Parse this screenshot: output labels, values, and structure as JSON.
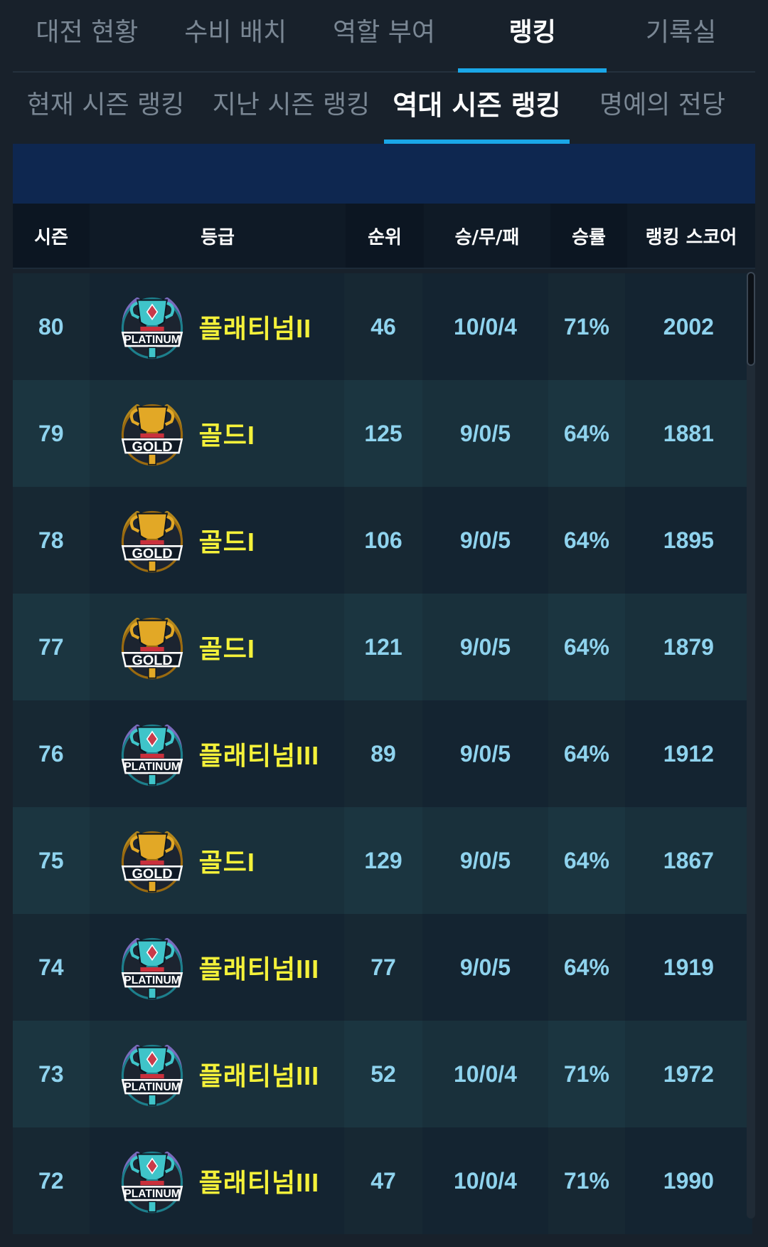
{
  "top_tabs": [
    "대전 현황",
    "수비 배치",
    "역할 부여",
    "랭킹",
    "기록실"
  ],
  "active_top_tab": "랭킹",
  "sub_tabs": [
    "현재 시즌 랭킹",
    "지난 시즌 랭킹",
    "역대 시즌 랭킹",
    "명예의 전당"
  ],
  "active_sub_tab": "역대 시즌 랭킹",
  "accent_color": "#1aa7e8",
  "grade_text_color": "#f4f13a",
  "value_text_color": "#8fd3ee",
  "table": {
    "headers": [
      "시즌",
      "등급",
      "순위",
      "승/무/패",
      "승률",
      "랭킹 스코어"
    ],
    "rows": [
      {
        "season": "80",
        "badge": "platinum-badge",
        "badge_text": "PLATINUM",
        "grade": "플래티넘II",
        "rank": "46",
        "wdl": "10/0/4",
        "rate": "71%",
        "score": "2002"
      },
      {
        "season": "79",
        "badge": "gold-badge",
        "badge_text": "GOLD",
        "grade": "골드I",
        "rank": "125",
        "wdl": "9/0/5",
        "rate": "64%",
        "score": "1881"
      },
      {
        "season": "78",
        "badge": "gold-badge",
        "badge_text": "GOLD",
        "grade": "골드I",
        "rank": "106",
        "wdl": "9/0/5",
        "rate": "64%",
        "score": "1895"
      },
      {
        "season": "77",
        "badge": "gold-badge",
        "badge_text": "GOLD",
        "grade": "골드I",
        "rank": "121",
        "wdl": "9/0/5",
        "rate": "64%",
        "score": "1879"
      },
      {
        "season": "76",
        "badge": "platinum-badge",
        "badge_text": "PLATINUM",
        "grade": "플래티넘III",
        "rank": "89",
        "wdl": "9/0/5",
        "rate": "64%",
        "score": "1912"
      },
      {
        "season": "75",
        "badge": "gold-badge",
        "badge_text": "GOLD",
        "grade": "골드I",
        "rank": "129",
        "wdl": "9/0/5",
        "rate": "64%",
        "score": "1867"
      },
      {
        "season": "74",
        "badge": "platinum-badge",
        "badge_text": "PLATINUM",
        "grade": "플래티넘III",
        "rank": "77",
        "wdl": "9/0/5",
        "rate": "64%",
        "score": "1919"
      },
      {
        "season": "73",
        "badge": "platinum-badge",
        "badge_text": "PLATINUM",
        "grade": "플래티넘III",
        "rank": "52",
        "wdl": "10/0/4",
        "rate": "71%",
        "score": "1972"
      },
      {
        "season": "72",
        "badge": "platinum-badge",
        "badge_text": "PLATINUM",
        "grade": "플래티넘III",
        "rank": "47",
        "wdl": "10/0/4",
        "rate": "71%",
        "score": "1990"
      }
    ]
  }
}
